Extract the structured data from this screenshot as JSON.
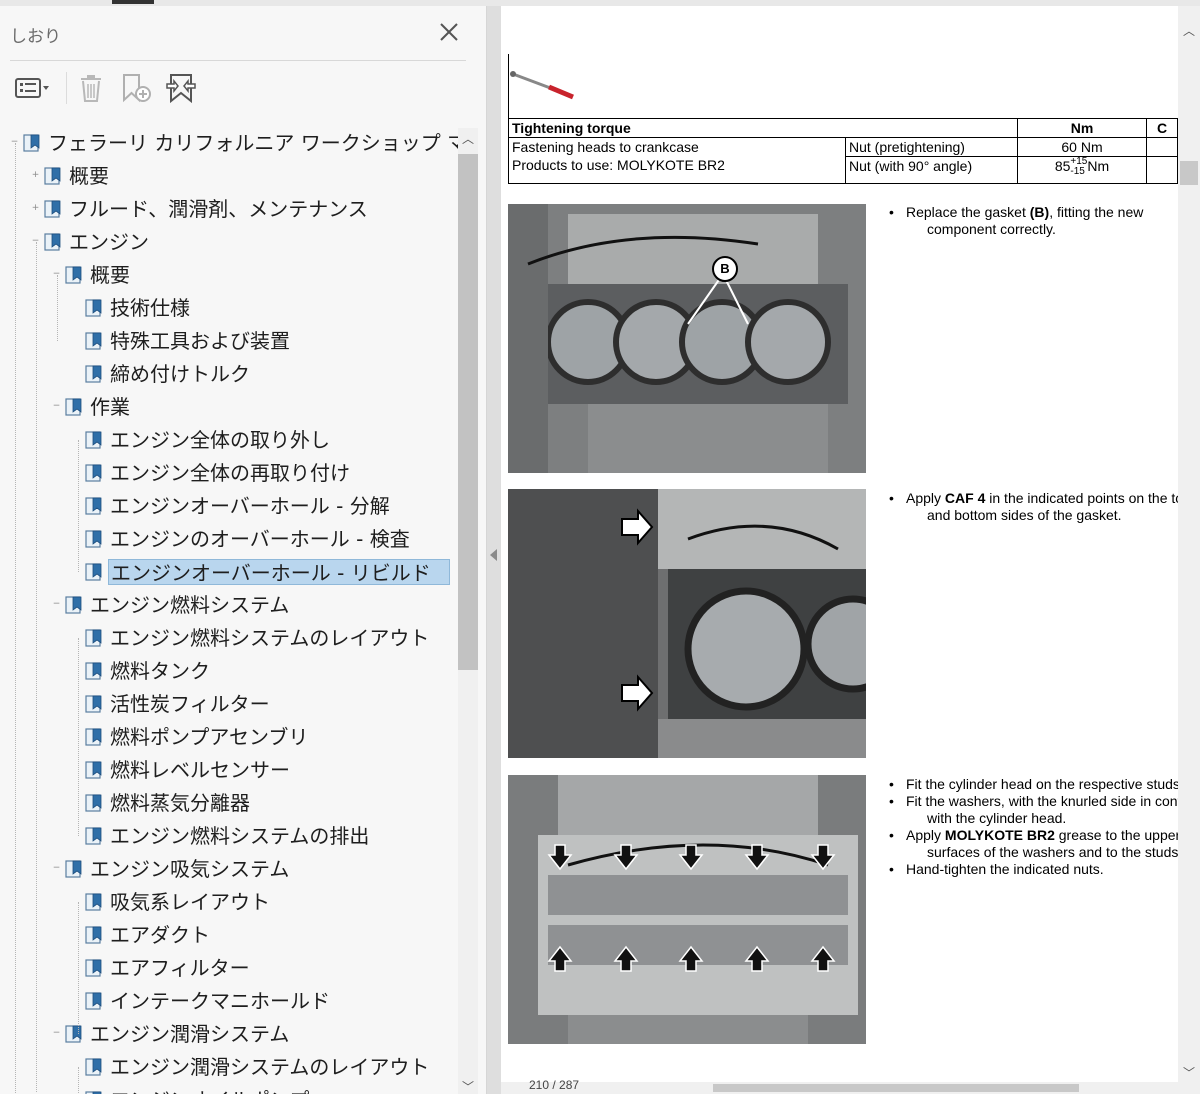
{
  "panel": {
    "title": "しおり",
    "toolbar": {
      "options_icon": "list-options-icon",
      "delete_icon": "trash-icon",
      "new_bookmark_icon": "add-bookmark-icon",
      "expand_icon": "expand-bookmark-icon"
    },
    "tree": [
      {
        "label": "フェラーリ カリフォルニア ワークショップ マニュアル",
        "level": 0,
        "expander": "−"
      },
      {
        "label": "概要",
        "level": 1,
        "expander": "+"
      },
      {
        "label": "フルード、潤滑剤、メンテナンス",
        "level": 1,
        "expander": "+"
      },
      {
        "label": "エンジン",
        "level": 1,
        "expander": "−"
      },
      {
        "label": "概要",
        "level": 2,
        "expander": "−"
      },
      {
        "label": "技術仕様",
        "level": 3,
        "expander": ""
      },
      {
        "label": "特殊工具および装置",
        "level": 3,
        "expander": ""
      },
      {
        "label": "締め付けトルク",
        "level": 3,
        "expander": ""
      },
      {
        "label": "作業",
        "level": 2,
        "expander": "−"
      },
      {
        "label": "エンジン全体の取り外し",
        "level": 3,
        "expander": ""
      },
      {
        "label": "エンジン全体の再取り付け",
        "level": 3,
        "expander": ""
      },
      {
        "label": "エンジンオーバーホール - 分解",
        "level": 3,
        "expander": ""
      },
      {
        "label": "エンジンのオーバーホール - 検査",
        "level": 3,
        "expander": ""
      },
      {
        "label": "エンジンオーバーホール - リビルド",
        "level": 3,
        "expander": "",
        "selected": true
      },
      {
        "label": "エンジン燃料システム",
        "level": 2,
        "expander": "−"
      },
      {
        "label": "エンジン燃料システムのレイアウト",
        "level": 3,
        "expander": ""
      },
      {
        "label": "燃料タンク",
        "level": 3,
        "expander": ""
      },
      {
        "label": "活性炭フィルター",
        "level": 3,
        "expander": ""
      },
      {
        "label": "燃料ポンプアセンブリ",
        "level": 3,
        "expander": ""
      },
      {
        "label": "燃料レベルセンサー",
        "level": 3,
        "expander": ""
      },
      {
        "label": "燃料蒸気分離器",
        "level": 3,
        "expander": ""
      },
      {
        "label": "エンジン燃料システムの排出",
        "level": 3,
        "expander": ""
      },
      {
        "label": "エンジン吸気システム",
        "level": 2,
        "expander": "−"
      },
      {
        "label": "吸気系レイアウト",
        "level": 3,
        "expander": ""
      },
      {
        "label": "エアダクト",
        "level": 3,
        "expander": ""
      },
      {
        "label": "エアフィルター",
        "level": 3,
        "expander": ""
      },
      {
        "label": "インテークマニホールド",
        "level": 3,
        "expander": ""
      },
      {
        "label": "エンジン潤滑システム",
        "level": 2,
        "expander": "−"
      },
      {
        "label": "エンジン潤滑システムのレイアウト",
        "level": 3,
        "expander": ""
      },
      {
        "label": "エンジンオイルポンプ",
        "level": 3,
        "expander": ""
      }
    ]
  },
  "document": {
    "table": {
      "header": {
        "col1": "Tightening torque",
        "col3": "Nm",
        "col4": "C"
      },
      "row1": {
        "desc_line1": "Fastening heads to crankcase",
        "desc_line2": "Products to use: MOLYKOTE BR2",
        "step1": "Nut (pretightening)",
        "val1": "60 Nm",
        "step2": "Nut (with 90° angle)",
        "val2_base": "85",
        "val2_sup": "+15",
        "val2_sub": "-15",
        "val2_unit": "Nm"
      }
    },
    "photo1_callout": "B",
    "steps1": [
      {
        "pre": "Replace the gasket ",
        "bold": "(B)",
        "post": ", fitting the new",
        "cont": "component correctly."
      }
    ],
    "steps2": [
      {
        "pre": "Apply ",
        "bold": "CAF 4",
        "post": " in the indicated points on the top",
        "cont": "and bottom sides of the gasket."
      }
    ],
    "steps3": [
      {
        "pre": "Fit the cylinder head on the respective studs.",
        "bold": "",
        "post": "",
        "cont": ""
      },
      {
        "pre": "Fit the washers, with the knurled side in contact",
        "bold": "",
        "post": "",
        "cont": "with the cylinder head."
      },
      {
        "pre": "Apply ",
        "bold": "MOLYKOTE BR2",
        "post": " grease to the upper",
        "cont": "surfaces of the washers and to the studs' threads."
      },
      {
        "pre": "Hand-tighten the indicated nuts.",
        "bold": "",
        "post": "",
        "cont": ""
      }
    ],
    "page_indicator": "210 / 287"
  }
}
